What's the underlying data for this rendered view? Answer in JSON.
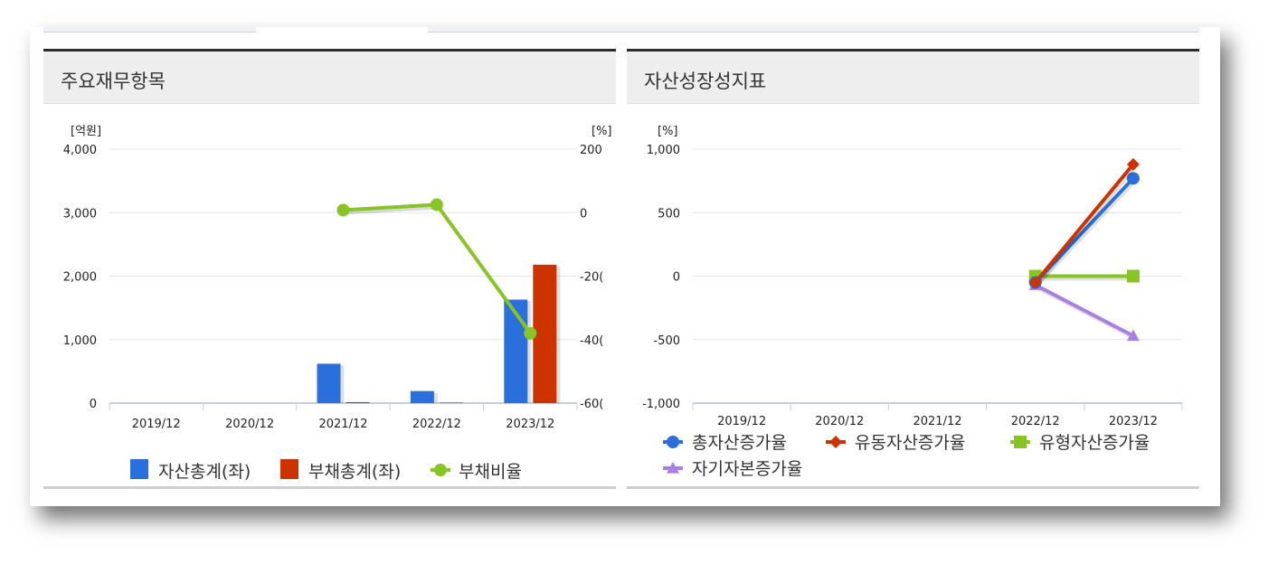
{
  "tabs": [
    {
      "label": ""
    },
    {
      "label": ""
    },
    {
      "label": ""
    }
  ],
  "panels": {
    "left": {
      "title": "주요재무항목"
    },
    "right": {
      "title": "자산성장성지표"
    }
  },
  "colors": {
    "asset_bar": "#2a6fdb",
    "liability_bar": "#cc3300",
    "ratio_line": "#88c425",
    "total_asset": "#2a6fdb",
    "current_asset": "#cc3300",
    "tangible_asset": "#88c425",
    "equity": "#a97fe0"
  },
  "chart_data": [
    {
      "type": "bar",
      "title": "주요재무항목",
      "categories": [
        "2019/12",
        "2020/12",
        "2021/12",
        "2022/12",
        "2023/12"
      ],
      "y_left": {
        "unit": "[억원]",
        "lim": [
          0,
          4000
        ],
        "ticks": [
          "0",
          "1,000",
          "2,000",
          "3,000",
          "4,000"
        ]
      },
      "y_right": {
        "unit": "[%]",
        "lim": [
          -600,
          200
        ],
        "ticks": [
          "-60(",
          "-40(",
          "-20(",
          "0",
          "200"
        ]
      },
      "series": [
        {
          "name": "자산총계(좌)",
          "type": "bar",
          "axis": "left",
          "values": [
            0,
            0,
            620,
            190,
            1630
          ]
        },
        {
          "name": "부채총계(좌)",
          "type": "bar",
          "axis": "left",
          "values": [
            0,
            0,
            15,
            8,
            2180
          ]
        },
        {
          "name": "부채비율",
          "type": "line",
          "axis": "right",
          "values": [
            null,
            null,
            8,
            25,
            -380
          ]
        }
      ],
      "legend": "bottom",
      "grid": true
    },
    {
      "type": "line",
      "title": "자산성장성지표",
      "categories": [
        "2019/12",
        "2020/12",
        "2021/12",
        "2022/12",
        "2023/12"
      ],
      "y": {
        "unit": "[%]",
        "lim": [
          -1000,
          1000
        ],
        "ticks": [
          "-1,000",
          "-500",
          "0",
          "500",
          "1,000"
        ]
      },
      "series": [
        {
          "name": "총자산증가율",
          "marker": "circle",
          "values": [
            null,
            null,
            null,
            -50,
            770
          ]
        },
        {
          "name": "유동자산증가율",
          "marker": "diamond",
          "values": [
            null,
            null,
            null,
            -50,
            880
          ]
        },
        {
          "name": "유형자산증가율",
          "marker": "square",
          "values": [
            null,
            null,
            null,
            0,
            0
          ]
        },
        {
          "name": "자기자본증가율",
          "marker": "triangle",
          "values": [
            null,
            null,
            null,
            -70,
            -470
          ]
        }
      ],
      "legend": "bottom",
      "grid": true
    }
  ]
}
